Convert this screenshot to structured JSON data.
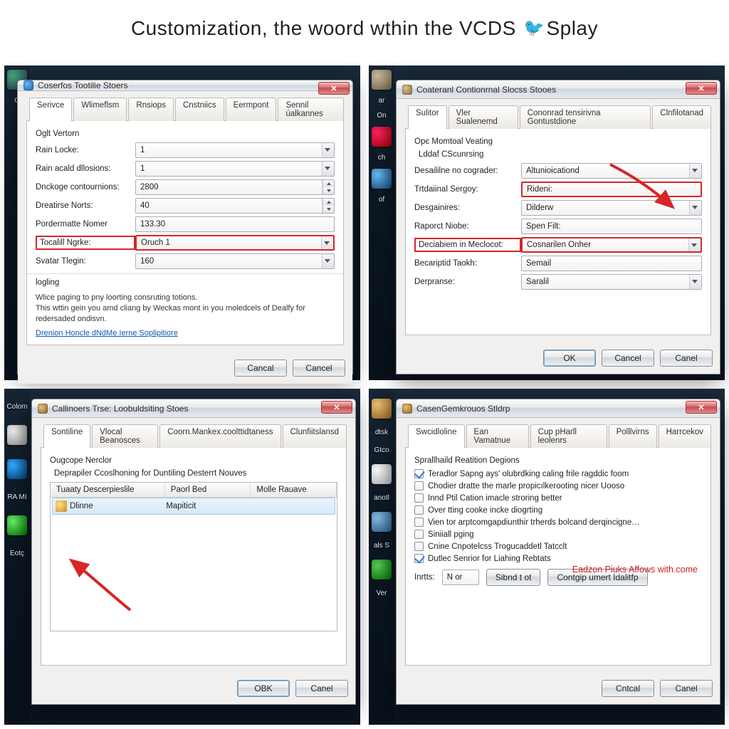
{
  "page": {
    "title_pre": "Customization, the woord wthin the VCDS ",
    "title_post": "Splay",
    "bird": "🐦"
  },
  "desktop": {
    "tl_labels": [
      "G"
    ],
    "tr_labels": [
      "ar",
      "On",
      "ch",
      "of"
    ],
    "bl_labels": [
      "Colom",
      "",
      "",
      "RA MI",
      "",
      "Eotç"
    ],
    "br_labels": [
      "dtsk",
      "Gtco",
      "",
      "anotl",
      "",
      "als S",
      "",
      "Ver"
    ]
  },
  "win_tl": {
    "title": "Coserfos Tootilie Stoers",
    "tabs": [
      "Serivce",
      "Wlimeflsm",
      "Rnsiops",
      "Cnstniics",
      "Eermpont",
      "Sennil úalkannes"
    ],
    "group": "Oglt Vertorn",
    "rows": [
      {
        "label": "Rain Locke:",
        "type": "combo",
        "value": "1"
      },
      {
        "label": "Rain acald dllosions:",
        "type": "combo",
        "value": "1"
      },
      {
        "label": "Dnckoge contournions:",
        "type": "spin",
        "value": "2800"
      },
      {
        "label": "Dreatirse Norts:",
        "type": "spin",
        "value": "40"
      },
      {
        "label": "Pordermatte Nomer",
        "type": "fld",
        "value": "133.30"
      }
    ],
    "hl_left_label": "Tocalill Ngrke:",
    "hl_right_value": "Oruch 1",
    "after_rows": [
      {
        "label": "Svatar Tlegin:",
        "type": "combo",
        "value": "160"
      }
    ],
    "logging_header": "logling",
    "desc_line1": "Wlice paging to pny loorting consruting totions.",
    "desc_line2": "This wttin gein you amd cliang by Weckas mont in you moledcels of Dealfy for redersaded ondisvn.",
    "link": "Drenion Honcle dNdMe Ierne Soplipitiore",
    "buttons": [
      "Cancal",
      "Cancel"
    ]
  },
  "win_tr": {
    "title": "Coateranl Contionrnal Slocss Stooes",
    "tabs": [
      "Sulitor",
      "Vler Sualenemd",
      "Cononrad tensirivna Gontustdione",
      "Clnfilotanad"
    ],
    "group": "Opє Momtoal Veating",
    "sub": "Lddaf CScunrsing",
    "rows": [
      {
        "label": "Desaililne no cograder:",
        "type": "combo",
        "value": "Altunioicationd"
      },
      {
        "label": "Trtdaiinal Sergoy:",
        "type": "fld",
        "value": "Rideni:",
        "hl": "right"
      },
      {
        "label": "Desgainires:",
        "type": "combo",
        "value": "Dilderw"
      },
      {
        "label": "Raporct Niobe:",
        "type": "fld",
        "value": "Spen Filt:"
      },
      {
        "label": "Deciabiem in Meclocot:",
        "type": "combo",
        "value": "Cosnarilen Onher",
        "hl": "both"
      },
      {
        "label": "Becariptid Taokh:",
        "type": "fld",
        "value": "Semail"
      },
      {
        "label": "Derpranse:",
        "type": "combo",
        "value": "Saralil"
      }
    ],
    "buttons": [
      "OK",
      "Cancel",
      "Canel"
    ]
  },
  "win_bl": {
    "title": "Callinoers Trse: Loobuldsiting Stoes",
    "tabs": [
      "Sontiline",
      "Vlocal Beanosces",
      "Coorn.Mankex.coolttidtaness",
      "Clunfiitslansd"
    ],
    "group": "Ougcope Nerclor",
    "sub": "Deprapiler Ccoslhoning for Duntiling Desterrt Nouves",
    "cols": [
      "Tuaaty Descerpieslile",
      "Paorl Bed",
      "Molle Rauave"
    ],
    "row": {
      "c1": "Dlinne",
      "c2": "Mapiticit",
      "c3": ""
    },
    "buttons": [
      "OBK",
      "Canel"
    ]
  },
  "win_br": {
    "title": "CasenGemkrouos Stldrp",
    "tabs": [
      "Swcidloline",
      "Ean Vamatnue",
      "Cup pHarll leolenrs",
      "Polllvirns",
      "Harrcekov"
    ],
    "group": "Sprallhaild Reatition Degions",
    "checks": [
      {
        "checked": true,
        "label": "Teradlor Sapng ays' olubrdking caling frile ragddic foom"
      },
      {
        "checked": false,
        "label": "Chodier dratte the marle propicılkerooting nicer Uooso"
      },
      {
        "checked": false,
        "label": "Innd Ptil Cation imacle stroring better"
      },
      {
        "checked": false,
        "label": "Over tting cooke incke diogrting"
      },
      {
        "checked": false,
        "label": "Vien tor arptcomgapdiunthir trherds bolcand derqincigne…"
      },
      {
        "checked": false,
        "label": "Siniiall pging"
      },
      {
        "checked": false,
        "label": "Cnine Cnpotelcss Trogucaddetl Tatcclt"
      },
      {
        "checked": true,
        "label": "Dutlec Senrior for Liahing Rebtats"
      }
    ],
    "red_text": "Eadzon Piuks Affows with.come",
    "inline": {
      "label": "Inrtts:",
      "field": "N or",
      "btn1": "Sibnd t ot",
      "btn2": "Contgip umert Idalitfp"
    },
    "buttons": [
      "Cntcal",
      "Canel"
    ]
  }
}
